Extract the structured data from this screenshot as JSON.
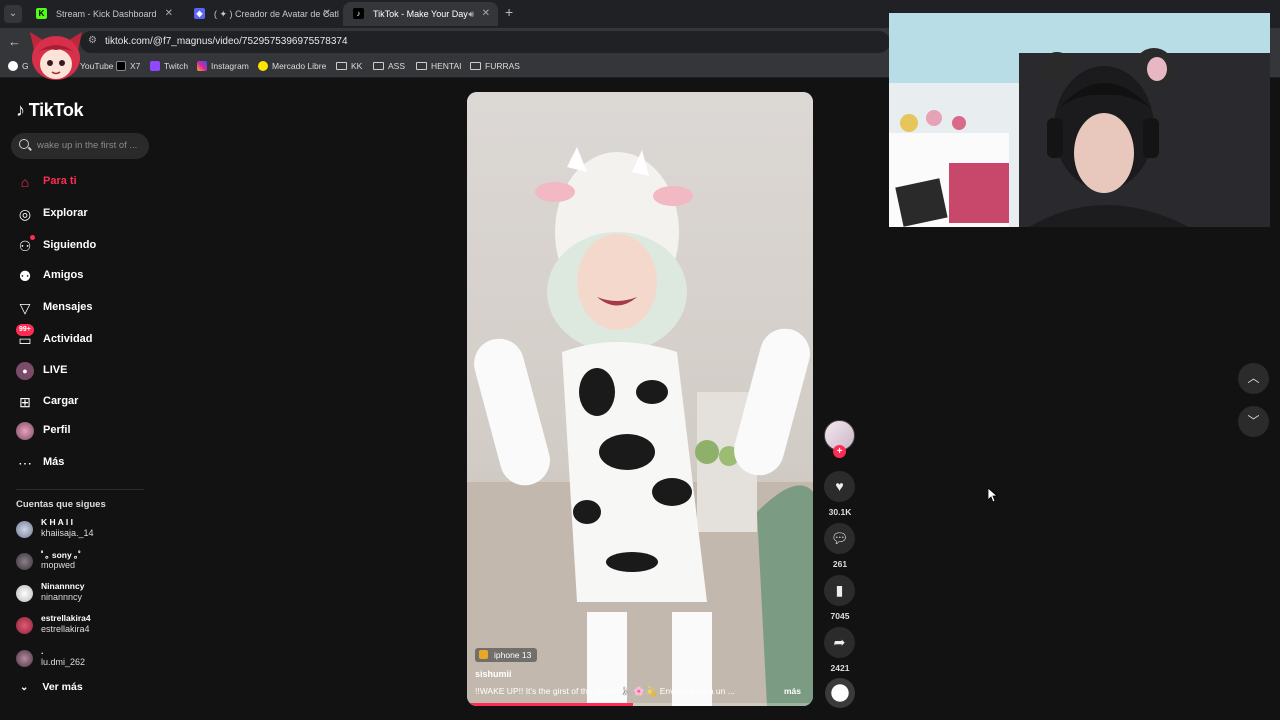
{
  "browser": {
    "tabs": [
      {
        "title": "Stream - Kick Dashboard",
        "icon": "kick-icon"
      },
      {
        "title": "( ✦ ) Creador de Avatar de Catl",
        "icon": "avatar-creator-icon"
      },
      {
        "title": "TikTok - Make Your Day",
        "icon": "tiktok-icon",
        "active": true
      }
    ],
    "url": "tiktok.com/@f7_magnus/video/7529575396975578374",
    "bookmarks": [
      "G",
      "YouTube",
      "X7",
      "Twitch",
      "Instagram",
      "Mercado Libre",
      "KK",
      "ASS",
      "HENTAI",
      "FURRAS"
    ]
  },
  "sidebar": {
    "logo": "TikTok",
    "search_placeholder": "wake up in the first of ...",
    "nav": [
      {
        "label": "Para ti",
        "icon": "home-icon",
        "active": true
      },
      {
        "label": "Explorar",
        "icon": "compass-icon"
      },
      {
        "label": "Siguiendo",
        "icon": "following-icon"
      },
      {
        "label": "Amigos",
        "icon": "friends-icon"
      },
      {
        "label": "Mensajes",
        "icon": "messages-icon"
      },
      {
        "label": "Actividad",
        "icon": "activity-icon",
        "badge": "99+"
      },
      {
        "label": "LIVE",
        "icon": "live-icon"
      },
      {
        "label": "Cargar",
        "icon": "upload-icon"
      },
      {
        "label": "Perfil",
        "icon": "profile-icon"
      },
      {
        "label": "Más",
        "icon": "more-icon"
      }
    ],
    "following_title": "Cuentas que sigues",
    "accounts": [
      {
        "name": "K H A I I",
        "handle": "khaiisaja._14"
      },
      {
        "name": "ﾟ｡ sony ｡ﾟ",
        "handle": "mopwed"
      },
      {
        "name": "Ninannncy",
        "handle": "ninannncy"
      },
      {
        "name": "estrellakira4",
        "handle": "estrellakira4"
      },
      {
        "name": ".",
        "handle": "lu.dmi_262"
      }
    ],
    "see_more": "Ver más"
  },
  "video": {
    "device_tag": "iphone 13",
    "username": "sishumii",
    "caption": "!!WAKE UP!! It's the girst of the month 🐰 🌸 💫 Envíale esto a un ...",
    "caption_more": "más",
    "progress": 0.48
  },
  "actions": {
    "likes": "30.1K",
    "comments": "261",
    "saves": "7045",
    "shares": "2421"
  },
  "colors": {
    "accent": "#fe2c55",
    "background": "#121212"
  }
}
